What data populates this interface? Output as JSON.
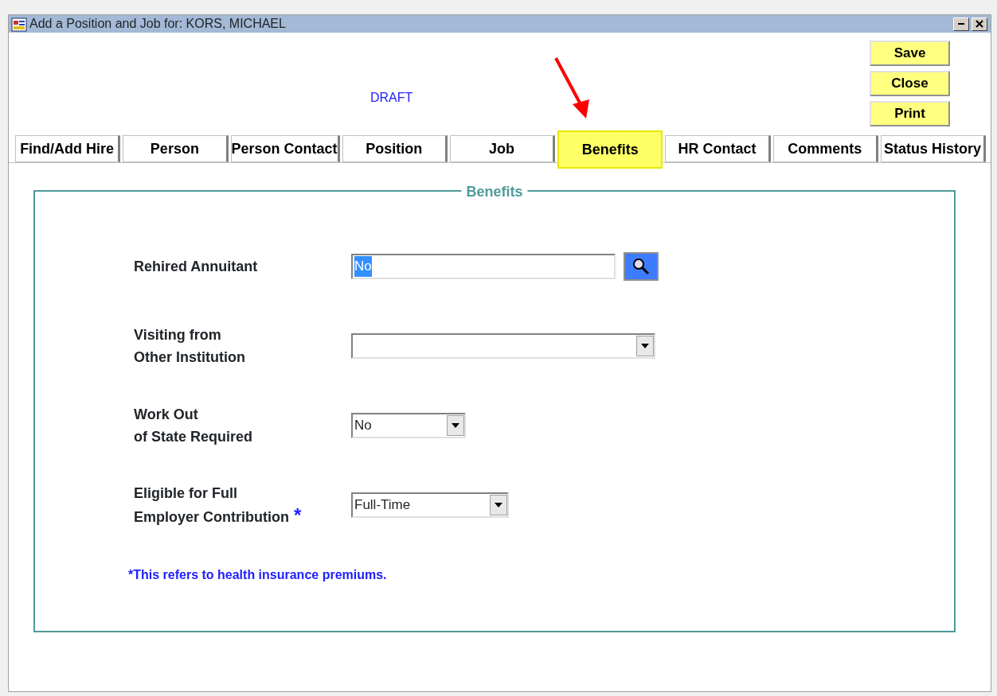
{
  "window": {
    "title": "Add a Position and Job for: KORS, MICHAEL"
  },
  "status_text": "DRAFT",
  "buttons": [
    "Save",
    "Close",
    "Print"
  ],
  "tabs": [
    {
      "label": "Find/Add Hire",
      "selected": false
    },
    {
      "label": "Person",
      "selected": false
    },
    {
      "label": "Person Contact",
      "selected": false
    },
    {
      "label": "Position",
      "selected": false
    },
    {
      "label": "Job",
      "selected": false
    },
    {
      "label": "Benefits",
      "selected": true
    },
    {
      "label": "HR Contact",
      "selected": false
    },
    {
      "label": "Comments",
      "selected": false
    },
    {
      "label": "Status History",
      "selected": false
    }
  ],
  "section": {
    "title": "Benefits",
    "fields": [
      {
        "kind": "lookup",
        "label_lines": [
          "Rehired Annuitant"
        ],
        "value": "No",
        "highlighted": true
      },
      {
        "kind": "select",
        "label_lines": [
          "Visiting from",
          "Other Institution"
        ]
      },
      {
        "kind": "select",
        "label_lines": [
          "Work Out",
          "of State Required"
        ],
        "value": "No"
      },
      {
        "kind": "select",
        "label_lines": [
          "Eligible for Full",
          "Employer Contribution"
        ],
        "required_marker": "*",
        "value": "Full-Time"
      }
    ],
    "footnote": {
      "marker": "*",
      "text": "This refers to health insurance premiums."
    }
  }
}
